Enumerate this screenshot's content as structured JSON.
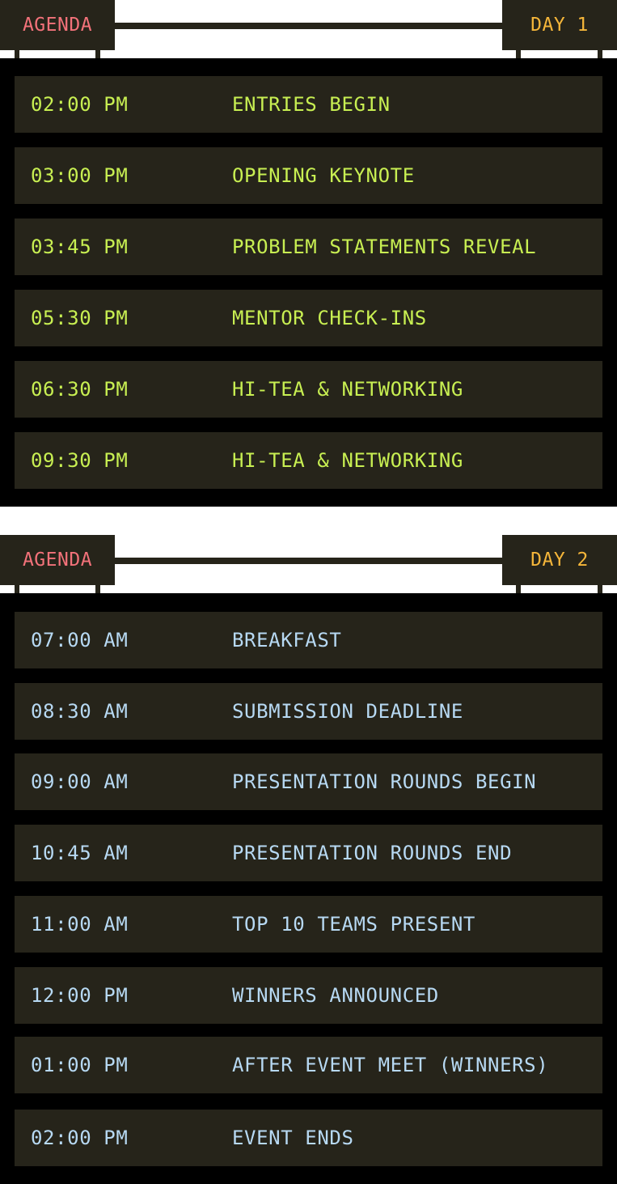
{
  "days": [
    {
      "agenda_label": "AGENDA",
      "day_label": "DAY 1",
      "items": [
        {
          "time": "02:00 PM",
          "event": "ENTRIES BEGIN"
        },
        {
          "time": "03:00 PM",
          "event": "OPENING KEYNOTE"
        },
        {
          "time": "03:45 PM",
          "event": "PROBLEM STATEMENTS REVEAL"
        },
        {
          "time": "05:30 PM",
          "event": "MENTOR CHECK-INS"
        },
        {
          "time": "06:30 PM",
          "event": "HI-TEA & NETWORKING"
        },
        {
          "time": "09:30 PM",
          "event": "HI-TEA & NETWORKING"
        }
      ]
    },
    {
      "agenda_label": "AGENDA",
      "day_label": "DAY 2",
      "items": [
        {
          "time": "07:00 AM",
          "event": "BREAKFAST"
        },
        {
          "time": "08:30 AM",
          "event": "SUBMISSION DEADLINE"
        },
        {
          "time": "09:00 AM",
          "event": "PRESENTATION ROUNDS BEGIN"
        },
        {
          "time": "10:45 AM",
          "event": "PRESENTATION ROUNDS END"
        },
        {
          "time": "11:00 AM",
          "event": "TOP 10 TEAMS PRESENT"
        },
        {
          "time": "12:00 PM",
          "event": "WINNERS ANNOUNCED"
        },
        {
          "time": "01:00 PM",
          "event": "AFTER EVENT MEET (WINNERS)"
        },
        {
          "time": "02:00 PM",
          "event": "EVENT ENDS"
        }
      ]
    }
  ],
  "colors": {
    "panel": "#26241a",
    "board": "#000000",
    "agenda_text": "#f3727a",
    "day_text": "#f5b63a",
    "day1_text": "#c8ef52",
    "day2_text": "#b7d9f3"
  }
}
